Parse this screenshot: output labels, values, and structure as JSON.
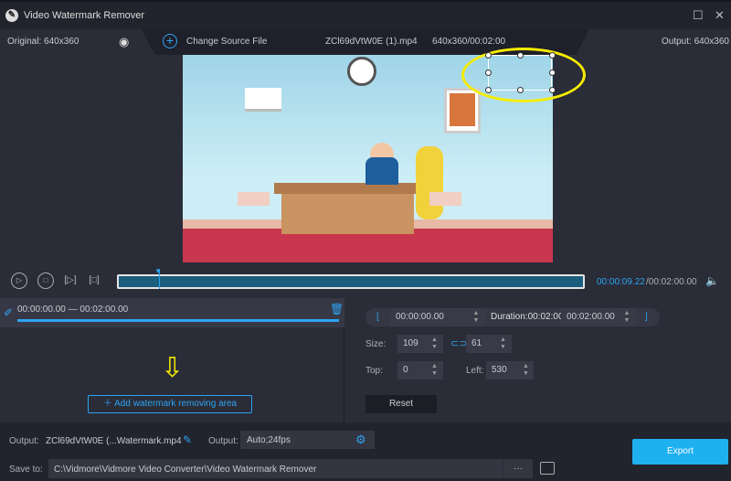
{
  "app": {
    "title": "Video Watermark Remover"
  },
  "info": {
    "original": "Original: 640x360",
    "change_source": "Change Source File",
    "filename": "ZCl69dVtW0E (1).mp4",
    "meta": "640x360/00:02:00",
    "output": "Output: 640x360"
  },
  "timeline": {
    "current": "00:00:09.22",
    "total": "/00:02:00.00",
    "progress": 0.077
  },
  "segment": {
    "range": "00:00:00.00 — 00:02:00.00"
  },
  "clip": {
    "start": "00:00:00.00",
    "duration": "Duration:00:02:00.00",
    "end": "00:02:00.00",
    "open_bracket": "[",
    "close_bracket": "]"
  },
  "area": {
    "size_label": "Size:",
    "width": "109",
    "height": "61",
    "top_label": "Top:",
    "top": "0",
    "left_label": "Left:",
    "left": "530",
    "reset": "Reset"
  },
  "add_area": "Add watermark removing area",
  "bottom": {
    "output_label": "Output:",
    "output_file": "ZCl69dVtW0E (...Watermark.mp4",
    "format_label": "Output:",
    "format": "Auto;24fps",
    "save_label": "Save to:",
    "save_path": "C:\\Vidmore\\Vidmore Video Converter\\Video Watermark Remover",
    "more": "···",
    "export": "Export"
  },
  "colors": {
    "accent": "#2ea3f2",
    "export": "#1fb0f0",
    "highlight": "#f5ec00"
  }
}
